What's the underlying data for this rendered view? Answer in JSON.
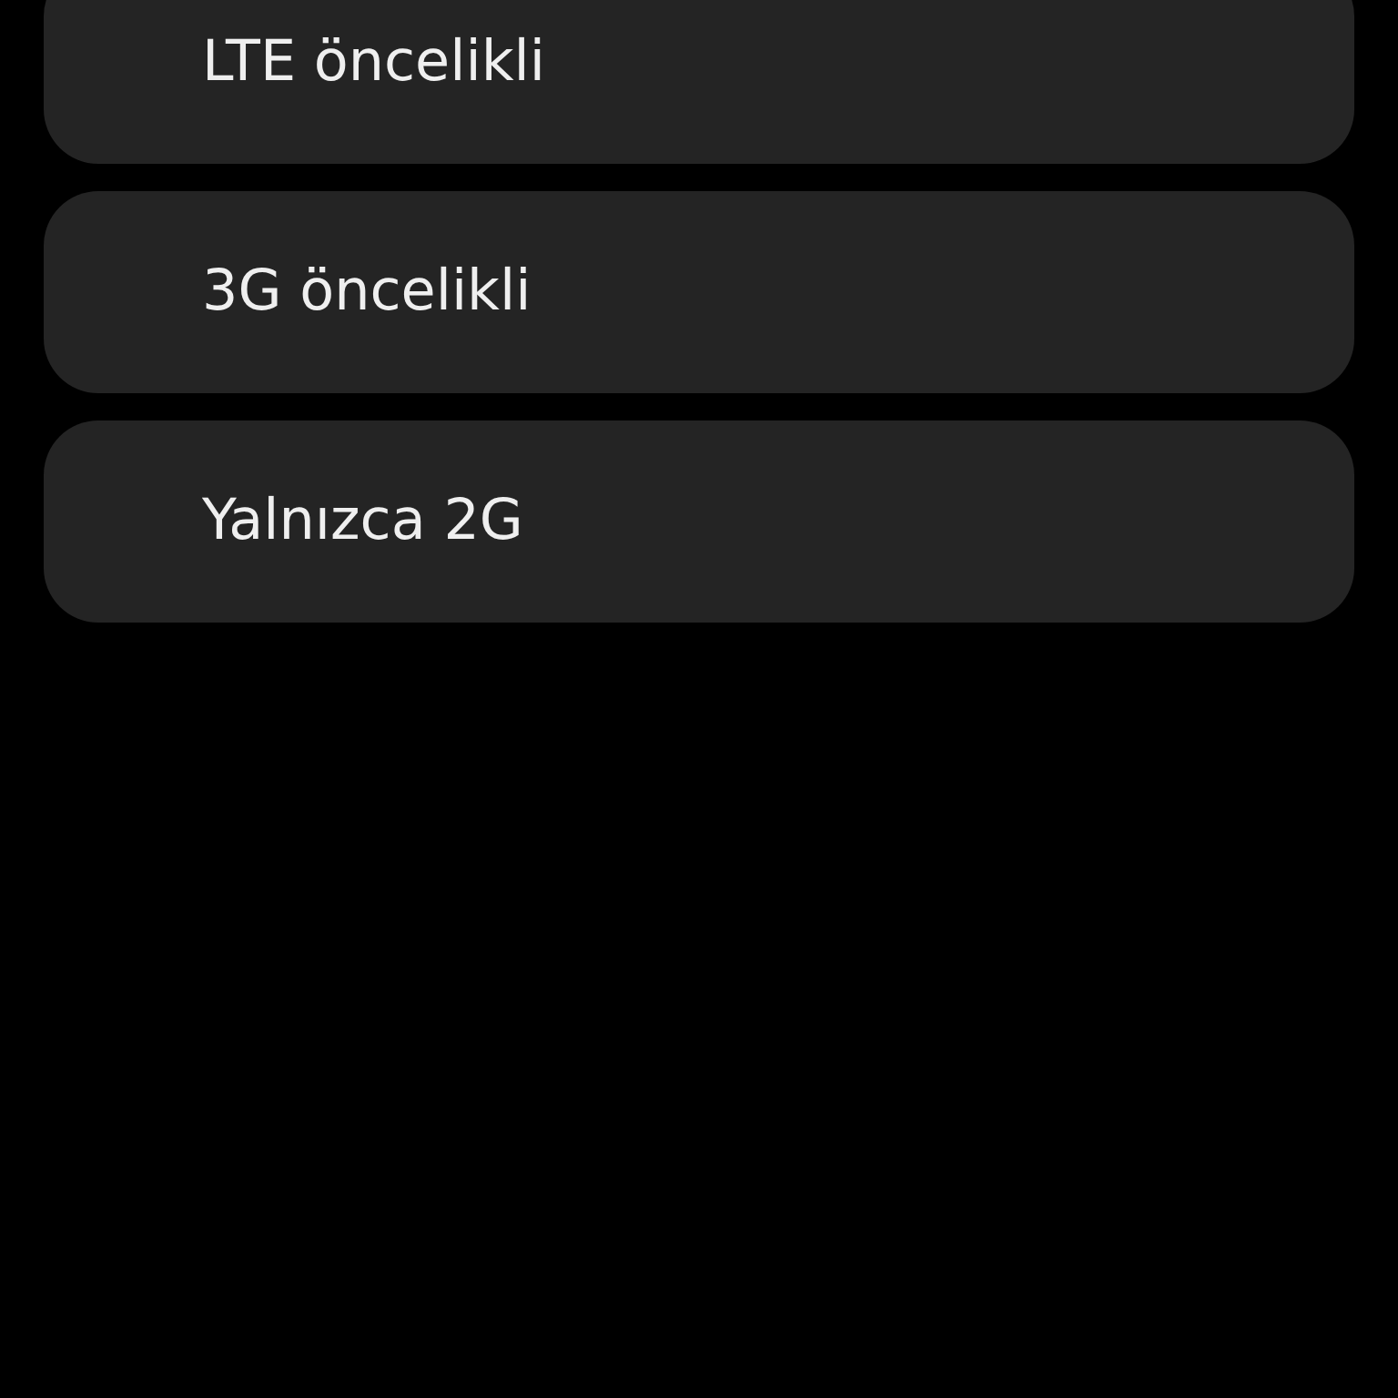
{
  "options": [
    {
      "label": "LTE öncelikli"
    },
    {
      "label": "3G öncelikli"
    },
    {
      "label": "Yalnızca 2G"
    }
  ]
}
